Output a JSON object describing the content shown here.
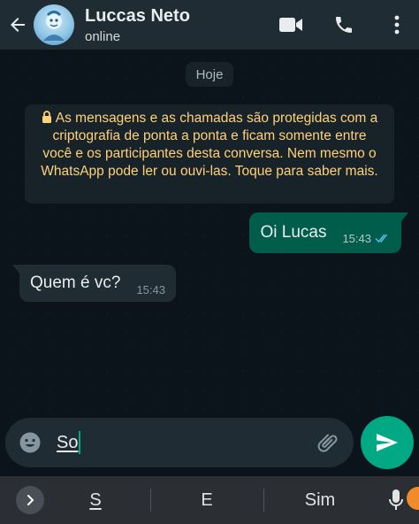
{
  "header": {
    "contact_name": "Luccas Neto",
    "status": "online",
    "icons": [
      "back-arrow-icon",
      "avatar",
      "video-call-icon",
      "phone-icon",
      "more-options-icon"
    ]
  },
  "chat": {
    "date_chip": "Hoje",
    "encryption_notice": "As mensagens e as chamadas são protegidas com a criptografia de ponta a ponta e ficam somente entre você e os participantes desta conversa. Nem mesmo o WhatsApp pode ler ou ouvi-las. Toque para saber mais.",
    "messages": [
      {
        "direction": "outgoing",
        "text": "Oi Lucas",
        "time": "15:43",
        "status": "read"
      },
      {
        "direction": "incoming",
        "text": "Quem é vc?",
        "time": "15:43"
      }
    ]
  },
  "composer": {
    "value": "So",
    "icons": [
      "emoji-icon",
      "attach-icon",
      "send-icon"
    ]
  },
  "keyboard": {
    "suggestions": [
      "S",
      "E",
      "Sim"
    ],
    "icons": [
      "chevron-right-icon",
      "mic-icon"
    ]
  },
  "colors": {
    "header_bg": "#1f2c34",
    "chat_bg": "#0b141a",
    "outgoing_bubble": "#005c4b",
    "incoming_bubble": "#202c33",
    "encryption_text": "#ffd279",
    "accent": "#00a884",
    "read_ticks": "#53bdeb"
  }
}
